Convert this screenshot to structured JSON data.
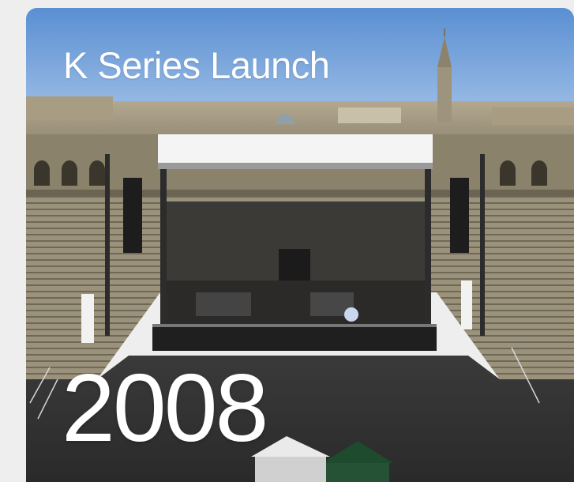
{
  "card": {
    "title": "K Series Launch",
    "year": "2008",
    "photo_subject": "concert-stage-in-roman-arena",
    "colors": {
      "sky": "#6f9fd9",
      "text": "#ffffff",
      "page_background": "#eeeeee"
    }
  }
}
